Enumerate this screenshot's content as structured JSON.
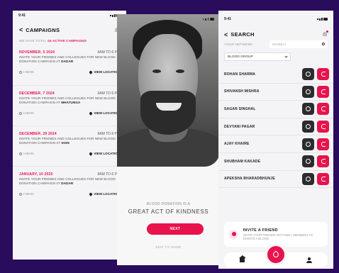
{
  "colors": {
    "accent": "#e8134d",
    "background": "#2a0c5c"
  },
  "status": {
    "time": "9:41"
  },
  "campaigns": {
    "title": "CAMPAIGNS",
    "subtitle_prefix": "WE HAVE TOTAL",
    "subtitle_count": "04 ACTIVE CAMPAIGNS",
    "going_label": "I AM IN",
    "location_label": "VIEW LOCATION",
    "items": [
      {
        "date": "NOVEMBER, 5 2024",
        "time": "9AM TO 6 PM",
        "desc": "INVITE YOUR FRIENDS AND COLLEGUES FOR NEW BLOOD DONATION CAMPAIGN AT",
        "place": "DADAR"
      },
      {
        "date": "DECEMBER, 7 2024",
        "time": "9AM TO 6 PM",
        "desc": "INVITE YOUR FRIENDS AND COLLEGUES FOR NEW BLOOD DONATION CAMPAIGN AT",
        "place": "MHATUNGA"
      },
      {
        "date": "DECEMBER, 29 2024",
        "time": "9AM TO 6 PM",
        "desc": "INVITE YOUR FRIENDS AND COLLEGUES FOR NEW BLOOD DONATION CAMPAIGN AT",
        "place": "SION"
      },
      {
        "date": "JANUARY, 10 2025",
        "time": "9AM TO 6 PM",
        "desc": "INVITE YOUR FRIENDS AND COLLEGUES FOR NEW BLOOD DONATION CAMPAIGN AT",
        "place": "DADAR"
      }
    ]
  },
  "onboarding": {
    "line1": "BLOOD DONATION IS A",
    "line2": "GREAT ACT OF KINDNESS",
    "next_label": "NEXT",
    "skip_label": "SKIP TO HOME"
  },
  "search": {
    "title": "SEARCH",
    "network_label": "YOUR NETWORK",
    "search_placeholder": "MUMBAI",
    "blood_group_label": "BLOOD GROUP",
    "donors": [
      "ROHAN SHARMA",
      "SHIVANSH MISHRA",
      "SAGAR SINGHAL",
      "DEVYANI PAGAR",
      "AJAY KHAIRE",
      "SHUBHAM KAKADE",
      "APEKSHA BHARADBHUNJE"
    ],
    "invite_title": "INVITE A FRIEND",
    "invite_sub": "INVITE YOUR FRIENDS OR FAMILY MEMBERS TO DONATE A BLOOD"
  }
}
